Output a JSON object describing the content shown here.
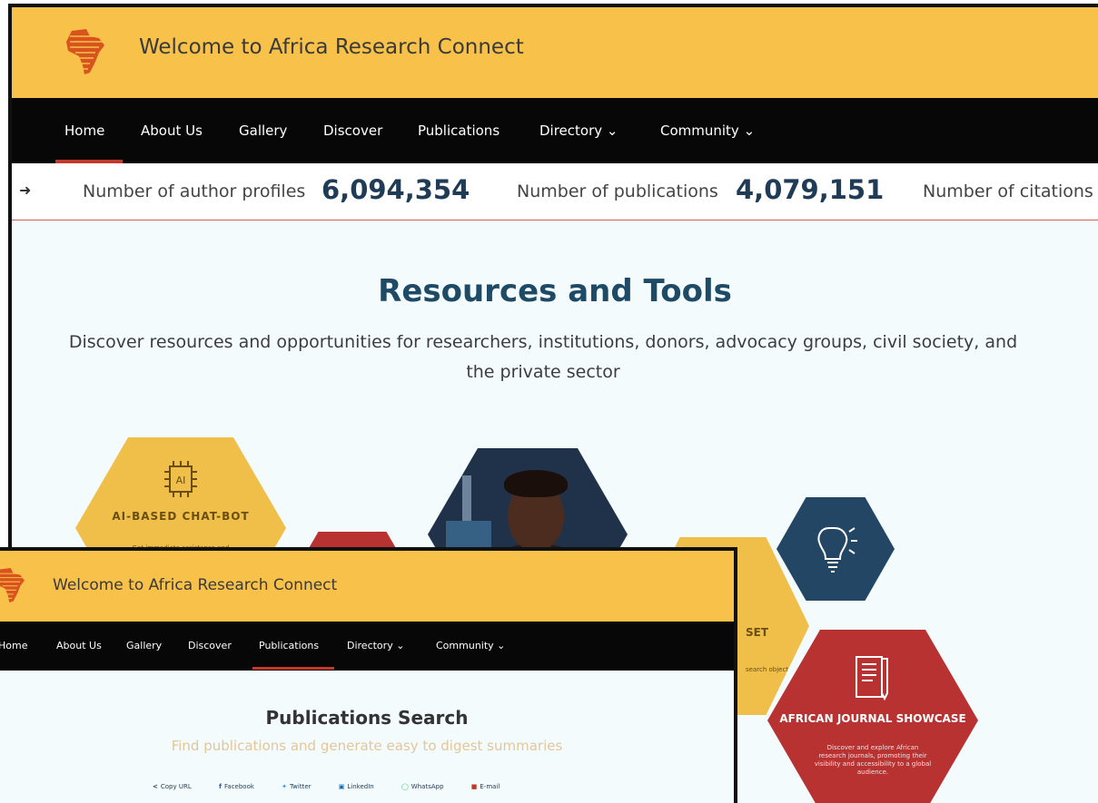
{
  "site_title": "Welcome to Africa Research Connect",
  "nav": [
    "Home",
    "About Us",
    "Gallery",
    "Discover",
    "Publications",
    "Directory",
    "Community"
  ],
  "dropdown_glyph": "⌄",
  "stats": {
    "author_label": "Number of author profiles",
    "author_value": "6,094,354",
    "pub_label": "Number of publications",
    "pub_value": "4,079,151",
    "citation_label": "Number of citations"
  },
  "resources": {
    "heading": "Resources and Tools",
    "subheading": "Discover resources and opportunities for researchers, institutions, donors, advocacy groups, civil society, and the private sector"
  },
  "cards": {
    "ai_icon_text": "AI",
    "ai_title": "AI-BASED CHAT-BOT",
    "ai_desc": "Get immediate assistance and",
    "gold2_title": "SET",
    "gold2_desc": "search objects",
    "journal_title": "AFRICAN JOURNAL SHOWCASE",
    "journal_desc": "Discover and explore African research journals, promoting their visibility and accessibility to a global audience."
  },
  "publications": {
    "heading": "Publications Search",
    "subheading": "Find publications and generate easy to digest summaries"
  },
  "share": [
    "Copy URL",
    "Facebook",
    "Twitter",
    "LinkedIn",
    "WhatsApp",
    "E-mail"
  ],
  "colors": {
    "header": "#f8c24a",
    "nav": "#070707",
    "accent": "#c0392b",
    "heading": "#1e4a66"
  }
}
